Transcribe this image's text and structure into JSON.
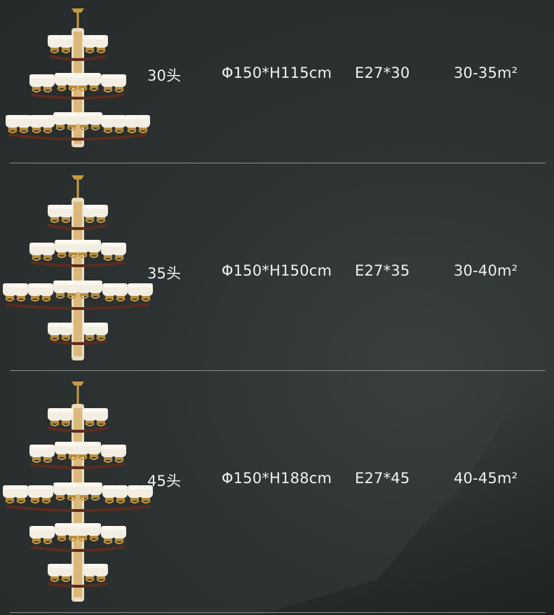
{
  "rows": [
    {
      "heads": "30头",
      "size": "Φ150*H115cm",
      "bulb": "E27*30",
      "area": "30-35m²"
    },
    {
      "heads": "35头",
      "size": "Φ150*H150cm",
      "bulb": "E27*35",
      "area": "30-40m²"
    },
    {
      "heads": "45头",
      "size": "Φ150*H188cm",
      "bulb": "E27*45",
      "area": "40-45m²"
    }
  ]
}
